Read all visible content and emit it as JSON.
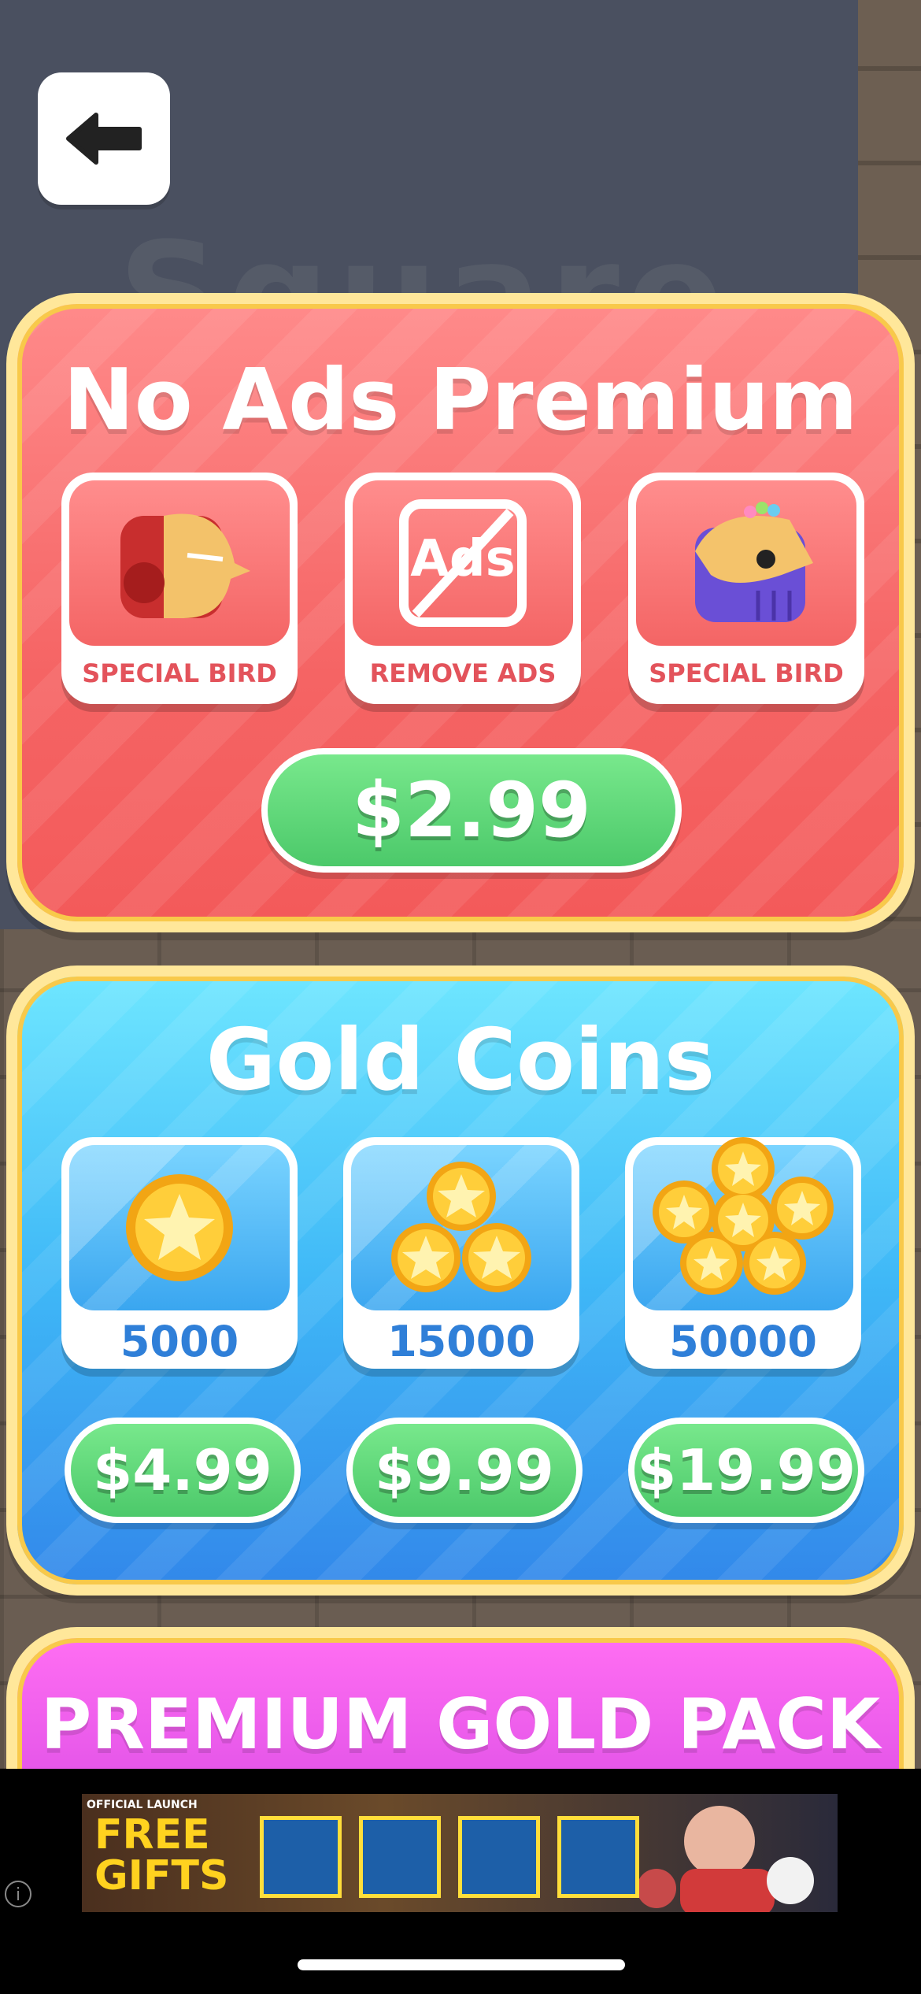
{
  "background": {
    "title_text": "Square"
  },
  "nav": {
    "back_icon": "arrow-left-icon"
  },
  "no_ads": {
    "title": "No Ads Premium",
    "items": [
      {
        "label": "SPECIAL BIRD",
        "icon": "iron-bird-icon"
      },
      {
        "label": "REMOVE ADS",
        "icon": "no-ads-icon",
        "icon_text": "Ads"
      },
      {
        "label": "SPECIAL BIRD",
        "icon": "purple-bird-icon"
      }
    ],
    "price": "$2.99"
  },
  "gold": {
    "title": "Gold Coins",
    "packs": [
      {
        "amount": "5000",
        "price": "$4.99",
        "icon": "single-coin-icon"
      },
      {
        "amount": "15000",
        "price": "$9.99",
        "icon": "three-coins-icon"
      },
      {
        "amount": "50000",
        "price": "$19.99",
        "icon": "coin-pile-icon"
      }
    ]
  },
  "premium_pack": {
    "title": "PREMIUM GOLD PACK"
  },
  "ad": {
    "tagline": "OFFICIAL LAUNCH",
    "headline_1": "FREE",
    "headline_2": "GIFTS",
    "info_icon": "info-icon"
  },
  "colors": {
    "red_panel": "#f56464",
    "blue_panel": "#3fb8f7",
    "pink_panel": "#d94be5",
    "price_green": "#4cc96a",
    "panel_border": "#ffe79a"
  }
}
